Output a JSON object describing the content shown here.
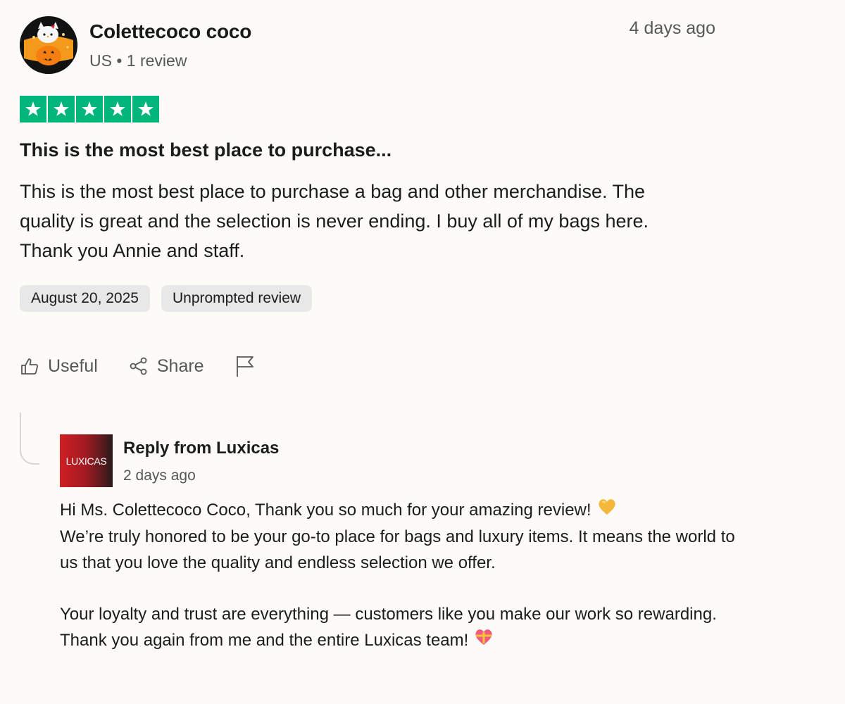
{
  "review": {
    "reviewer_name": "Colettecoco coco",
    "reviewer_meta": "US • 1 review",
    "posted_ago": "4 days ago",
    "rating": 5,
    "rating_max": 5,
    "star_color": "#00b67a",
    "title": "This is the most best place to purchase...",
    "body": "This is the most best place to purchase a bag and other merchandise. The quality is great and the selection is never ending. I buy all of my bags here. Thank you Annie and staff.",
    "tags": [
      "August 20, 2025",
      "Unprompted review"
    ]
  },
  "actions": {
    "useful_label": "Useful",
    "share_label": "Share",
    "useful_icon": "thumbs-up-icon",
    "share_icon": "share-icon",
    "report_icon": "flag-icon"
  },
  "reply": {
    "logo_text": "LUXICAS",
    "title": "Reply from Luxicas",
    "date": "2 days ago",
    "line1": "Hi Ms. Colettecoco Coco, Thank you so much for your amazing review!",
    "line2": "We’re truly honored to be your go-to place for bags and luxury items. It means the world to us that you love the quality and endless selection we offer.",
    "line3": "Your loyalty and trust are everything — customers like you make our work so rewarding.",
    "line4": "Thank you again from me and the entire Luxicas team!",
    "emoji1": "yellow-heart-icon",
    "emoji2": "heart-with-ribbon-icon"
  }
}
